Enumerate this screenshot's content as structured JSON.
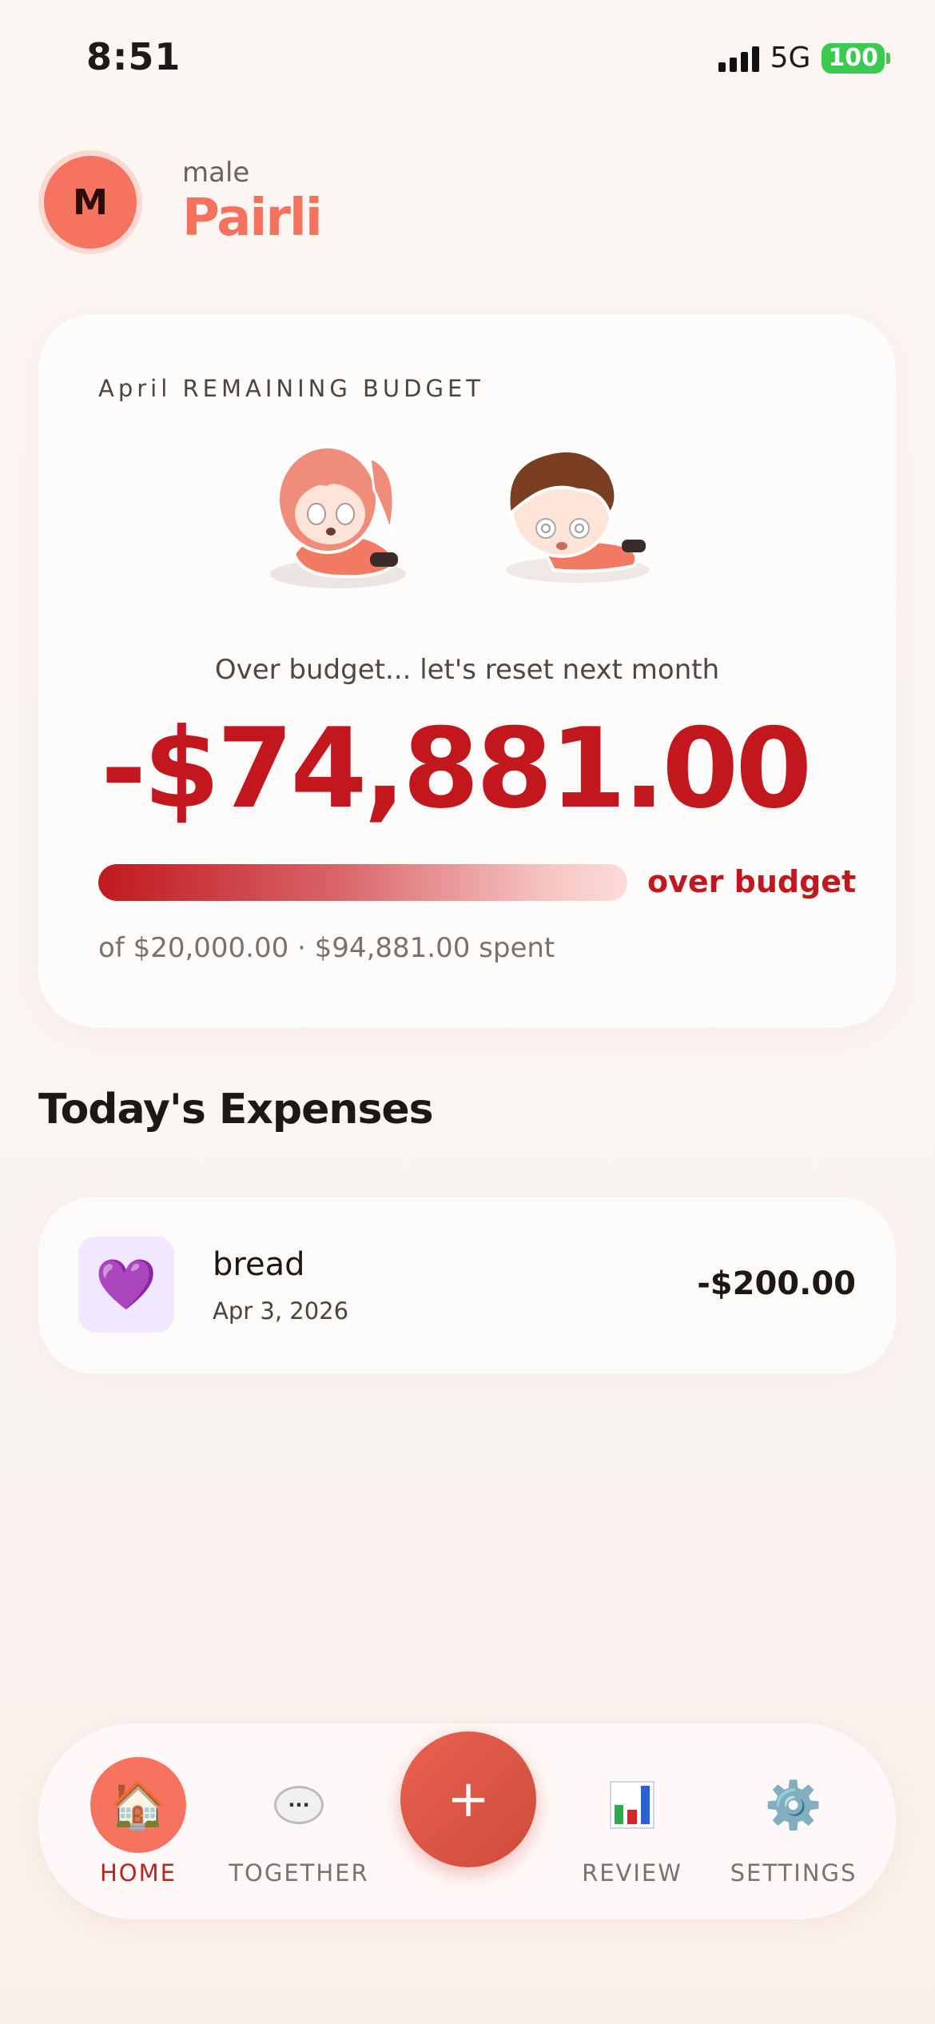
{
  "status_bar": {
    "time": "8:51",
    "network": "5G",
    "battery": "100",
    "battery_color": "#3bc94f"
  },
  "header": {
    "avatar_initial": "M",
    "subtitle": "male",
    "title": "Pairli",
    "accent_color": "#f5735e"
  },
  "budget": {
    "label": "April REMAINING BUDGET",
    "message": "Over budget... let's reset next month",
    "amount": "-$74,881.00",
    "status": "over budget",
    "detail": "of $20,000.00 · $94,881.00 spent",
    "progress_fraction": 1.0,
    "amount_color": "#c2171d",
    "mascots": [
      "girl-mascot-icon",
      "boy-mascot-icon"
    ]
  },
  "expenses": {
    "title": "Today's Expenses",
    "items": [
      {
        "icon": "💜",
        "icon_name": "purple-heart-icon",
        "name": "bread",
        "date": "Apr 3, 2026",
        "amount": "-$200.00"
      }
    ]
  },
  "nav": {
    "home": {
      "label": "HOME",
      "icon": "🏠"
    },
    "together": {
      "label": "TOGETHER",
      "icon": "speech-bubble-icon"
    },
    "add": {
      "label": "+"
    },
    "review": {
      "label": "REVIEW",
      "icon": "bar-chart-icon"
    },
    "settings": {
      "label": "SETTINGS",
      "icon": "⚙️"
    }
  }
}
